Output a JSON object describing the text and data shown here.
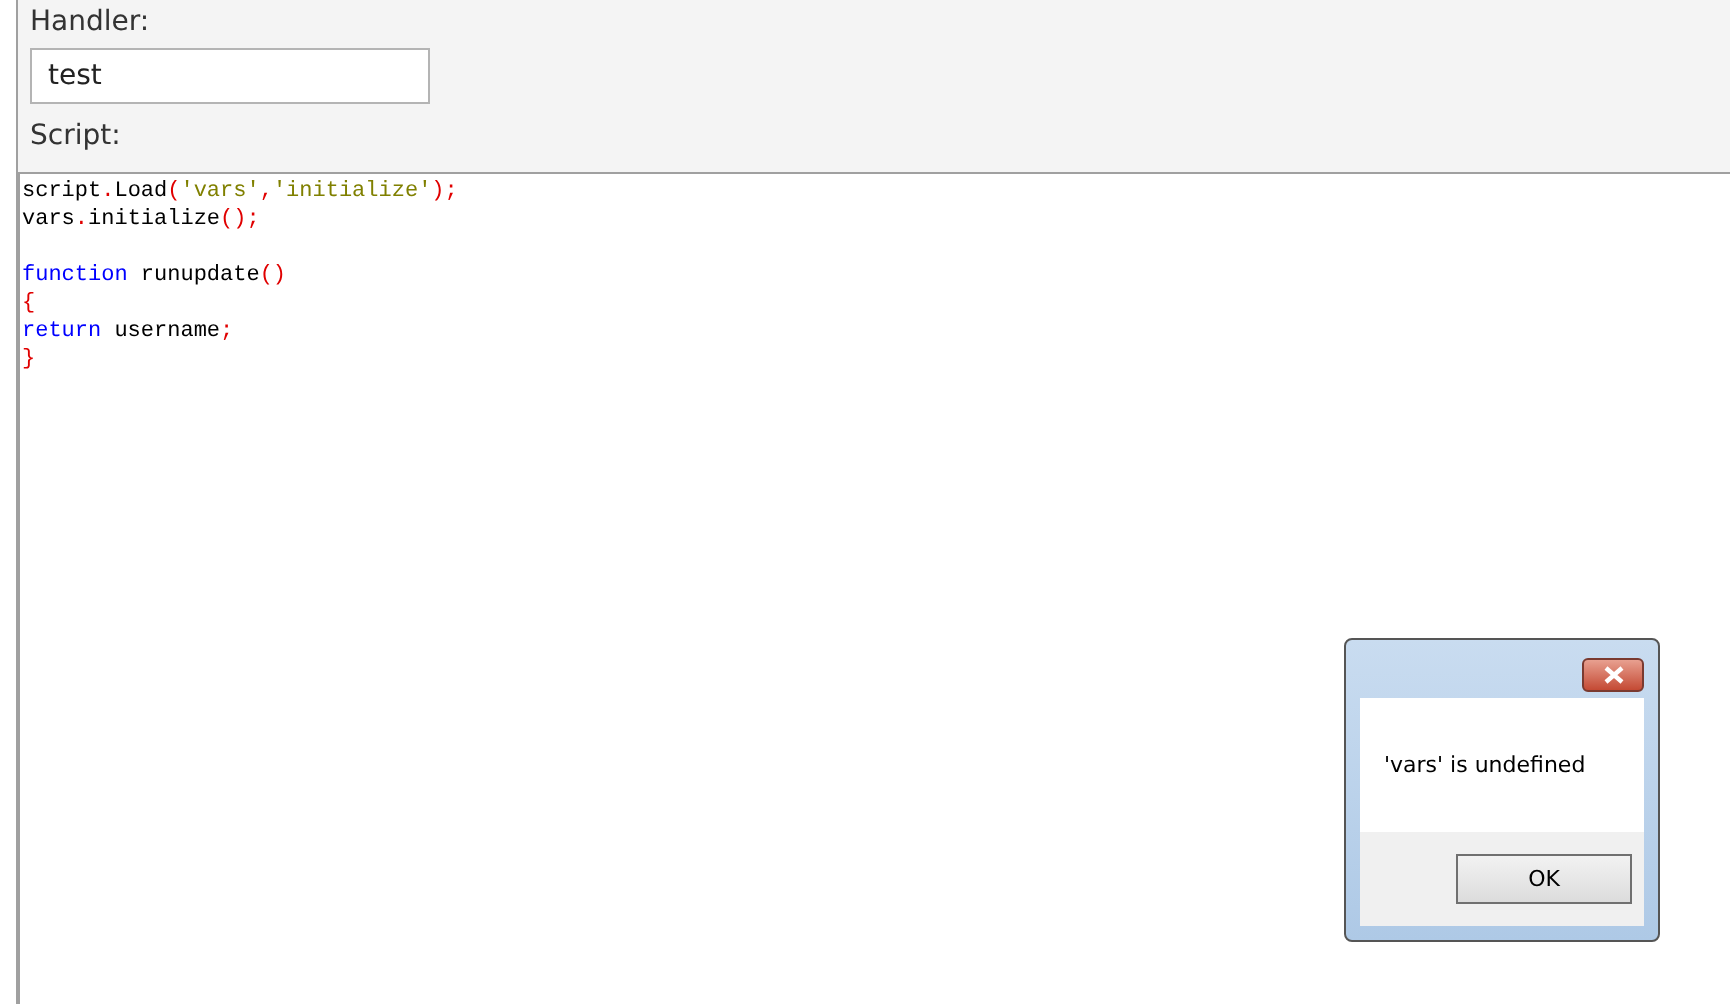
{
  "handler": {
    "label": "Handler:",
    "value": "test"
  },
  "script": {
    "label": "Script:",
    "lines": [
      {
        "kind": "code",
        "tokens": [
          {
            "color": "#000000",
            "text": "script"
          },
          {
            "color": "#e00000",
            "text": "."
          },
          {
            "color": "#000000",
            "text": "Load"
          },
          {
            "color": "#e00000",
            "text": "("
          },
          {
            "color": "#808000",
            "text": "'vars'"
          },
          {
            "color": "#e00000",
            "text": ","
          },
          {
            "color": "#808000",
            "text": "'initialize'"
          },
          {
            "color": "#e00000",
            "text": ");"
          }
        ]
      },
      {
        "kind": "code",
        "tokens": [
          {
            "color": "#000000",
            "text": "vars"
          },
          {
            "color": "#e00000",
            "text": "."
          },
          {
            "color": "#000000",
            "text": "initialize"
          },
          {
            "color": "#e00000",
            "text": "();"
          }
        ]
      },
      {
        "kind": "blank"
      },
      {
        "kind": "code",
        "tokens": [
          {
            "color": "#0000ff",
            "text": "function"
          },
          {
            "color": "#000000",
            "text": " runupdate"
          },
          {
            "color": "#e00000",
            "text": "()"
          }
        ]
      },
      {
        "kind": "code",
        "tokens": [
          {
            "color": "#e00000",
            "text": "{"
          }
        ]
      },
      {
        "kind": "code",
        "tokens": [
          {
            "color": "#0000ff",
            "text": "return"
          },
          {
            "color": "#000000",
            "text": " username"
          },
          {
            "color": "#e00000",
            "text": ";"
          }
        ]
      },
      {
        "kind": "code",
        "tokens": [
          {
            "color": "#e00000",
            "text": "}"
          }
        ]
      }
    ]
  },
  "dialog": {
    "message": "'vars' is undefined",
    "button": "OK"
  }
}
